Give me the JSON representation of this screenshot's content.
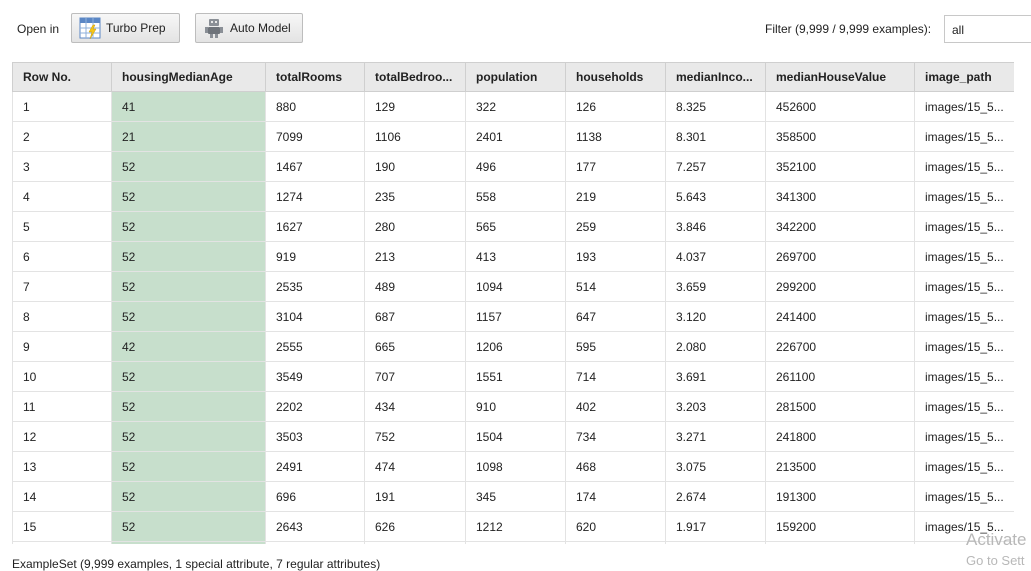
{
  "toolbar": {
    "open_in_label": "Open in",
    "turbo_prep_label": "Turbo Prep",
    "turbo_prep_icon": "turbo-prep-icon",
    "auto_model_label": "Auto Model",
    "auto_model_icon": "robot-icon",
    "filter_label": "Filter (9,999 / 9,999 examples):",
    "filter_value": "all"
  },
  "table": {
    "columns": [
      "Row No.",
      "housingMedianAge",
      "totalRooms",
      "totalBedroo...",
      "population",
      "households",
      "medianInco...",
      "medianHouseValue",
      "image_path"
    ],
    "selected_column_color": "#c7dfcc",
    "rows": [
      [
        "1",
        "41",
        "880",
        "129",
        "322",
        "126",
        "8.325",
        "452600",
        "images/15_5..."
      ],
      [
        "2",
        "21",
        "7099",
        "1106",
        "2401",
        "1138",
        "8.301",
        "358500",
        "images/15_5..."
      ],
      [
        "3",
        "52",
        "1467",
        "190",
        "496",
        "177",
        "7.257",
        "352100",
        "images/15_5..."
      ],
      [
        "4",
        "52",
        "1274",
        "235",
        "558",
        "219",
        "5.643",
        "341300",
        "images/15_5..."
      ],
      [
        "5",
        "52",
        "1627",
        "280",
        "565",
        "259",
        "3.846",
        "342200",
        "images/15_5..."
      ],
      [
        "6",
        "52",
        "919",
        "213",
        "413",
        "193",
        "4.037",
        "269700",
        "images/15_5..."
      ],
      [
        "7",
        "52",
        "2535",
        "489",
        "1094",
        "514",
        "3.659",
        "299200",
        "images/15_5..."
      ],
      [
        "8",
        "52",
        "3104",
        "687",
        "1157",
        "647",
        "3.120",
        "241400",
        "images/15_5..."
      ],
      [
        "9",
        "42",
        "2555",
        "665",
        "1206",
        "595",
        "2.080",
        "226700",
        "images/15_5..."
      ],
      [
        "10",
        "52",
        "3549",
        "707",
        "1551",
        "714",
        "3.691",
        "261100",
        "images/15_5..."
      ],
      [
        "11",
        "52",
        "2202",
        "434",
        "910",
        "402",
        "3.203",
        "281500",
        "images/15_5..."
      ],
      [
        "12",
        "52",
        "3503",
        "752",
        "1504",
        "734",
        "3.271",
        "241800",
        "images/15_5..."
      ],
      [
        "13",
        "52",
        "2491",
        "474",
        "1098",
        "468",
        "3.075",
        "213500",
        "images/15_5..."
      ],
      [
        "14",
        "52",
        "696",
        "191",
        "345",
        "174",
        "2.674",
        "191300",
        "images/15_5..."
      ],
      [
        "15",
        "52",
        "2643",
        "626",
        "1212",
        "620",
        "1.917",
        "159200",
        "images/15_5..."
      ],
      [
        "",
        "",
        "",
        "",
        "",
        "",
        "",
        "",
        ""
      ]
    ]
  },
  "status": "ExampleSet (9,999 examples, 1 special attribute, 7 regular attributes)",
  "watermark": {
    "line1": "Activate",
    "line2": "Go to Sett"
  }
}
